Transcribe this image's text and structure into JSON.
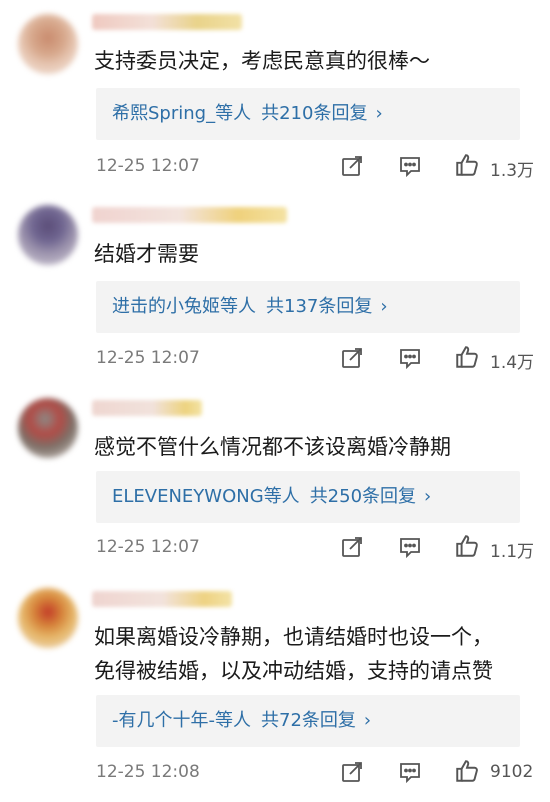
{
  "comments": [
    {
      "text": "支持委员决定，考虑民意真的很棒～",
      "reply_users": "希熙Spring_",
      "reply_suffix": "等人",
      "reply_count": "共210条回复",
      "time": "12-25 12:07",
      "likes": "1.3万"
    },
    {
      "text": "结婚才需要",
      "reply_users": "进击的小兔姬",
      "reply_suffix": "等人",
      "reply_count": "共137条回复",
      "time": "12-25 12:07",
      "likes": "1.4万"
    },
    {
      "text": "感觉不管什么情况都不该设离婚冷静期",
      "reply_users": "ELEVENEYWONG",
      "reply_suffix": "等人",
      "reply_count": "共250条回复",
      "time": "12-25 12:07",
      "likes": "1.1万"
    },
    {
      "text_line1": "如果离婚设冷静期，也请结婚时也设一个，",
      "text_line2": "免得被结婚，以及冲动结婚，支持的请点赞",
      "reply_users": "-有几个十年-",
      "reply_suffix": "等人",
      "reply_count": "共72条回复",
      "time": "12-25 12:08",
      "likes": "9102"
    }
  ],
  "icons": {
    "share": "share-icon",
    "comment": "comment-icon",
    "like": "thumbs-up-icon"
  },
  "colors": {
    "link": "#2e6fa7",
    "meta": "#7a7a7a",
    "reply_bg": "#f3f3f3"
  }
}
